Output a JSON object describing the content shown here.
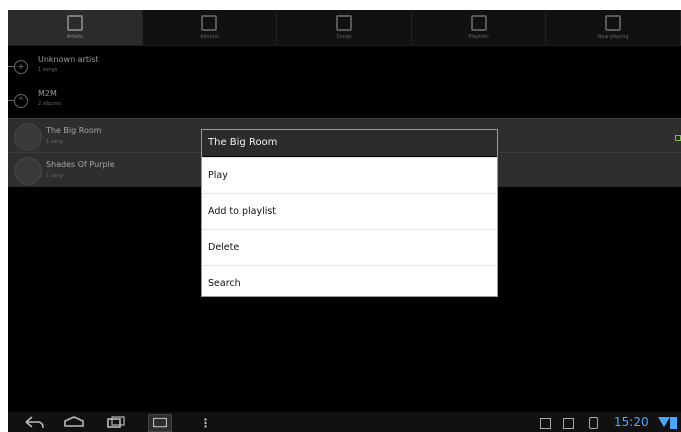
{
  "tabs": [
    {
      "label": "Artists",
      "icon": "artist-icon",
      "active": true
    },
    {
      "label": "Albums",
      "icon": "album-icon",
      "active": false
    },
    {
      "label": "Songs",
      "icon": "song-icon",
      "active": false
    },
    {
      "label": "Playlists",
      "icon": "playlist-icon",
      "active": false
    },
    {
      "label": "Now playing",
      "icon": "now-playing-icon",
      "active": false
    }
  ],
  "artists": [
    {
      "title": "Unknown artist",
      "sub": "1 songs",
      "expand_symbol": "+"
    },
    {
      "title": "M2M",
      "sub": "2 albums",
      "expand_symbol": "^"
    }
  ],
  "albums": [
    {
      "title": "The Big Room",
      "sub": "1 song"
    },
    {
      "title": "Shades Of Purple",
      "sub": "1 song"
    }
  ],
  "dialog": {
    "title": "The Big Room",
    "items": [
      "Play",
      "Add to playlist",
      "Delete",
      "Search"
    ]
  },
  "statusbar": {
    "time": "15:20"
  },
  "colors": {
    "accent": "#4aa8ff",
    "indicator": "#7ac142"
  }
}
